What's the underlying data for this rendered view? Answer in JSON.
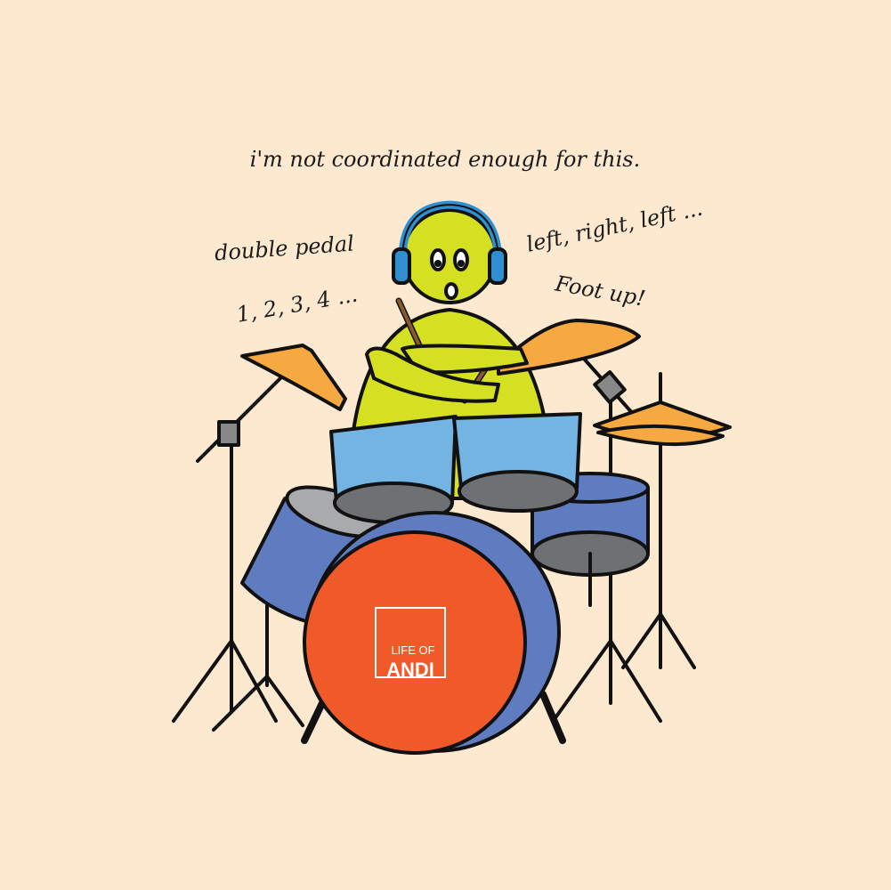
{
  "captions": {
    "top": "i'm not coordinated enough for this.",
    "left_line1": "double pedal",
    "left_line2": "1, 2, 3, 4 ...",
    "right_line1": "left, right, left ...",
    "right_line2": "Foot up!"
  },
  "logo": {
    "line1": "LIFE OF",
    "line2": "ANDI"
  },
  "colors": {
    "background": "#fde8d0",
    "character": "#d4e021",
    "headphones": "#2f8fd0",
    "cymbal": "#f7a941",
    "tom": "#74b4e3",
    "drum_shell": "#5f7cc1",
    "drum_head": "#6f7073",
    "bass_head": "#f05a28",
    "outline": "#111111"
  }
}
